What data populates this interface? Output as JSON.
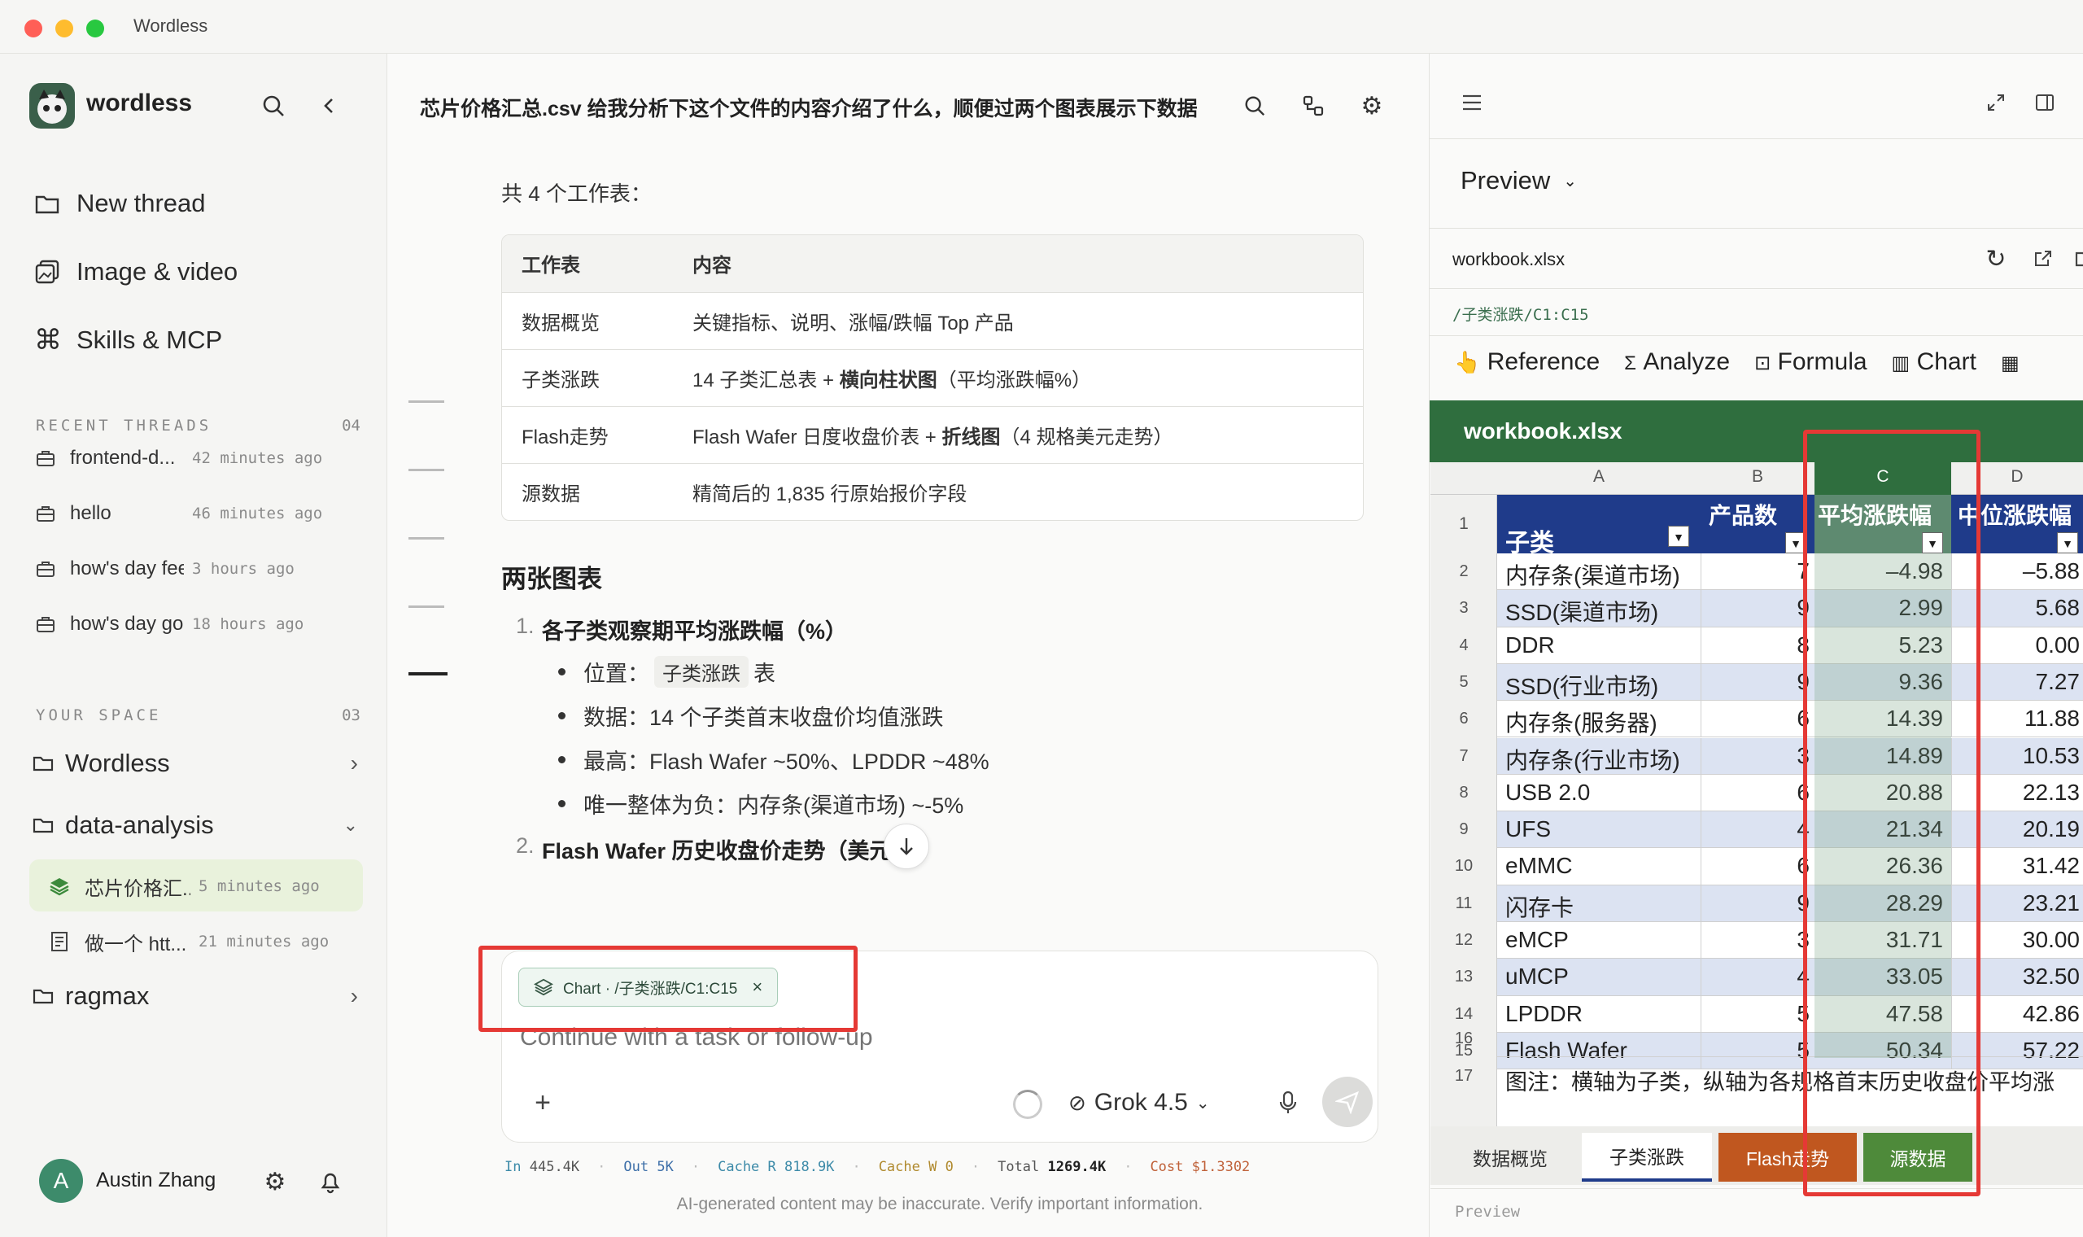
{
  "app": {
    "title": "Wordless"
  },
  "sidebar": {
    "brand": "wordless",
    "nav": [
      {
        "label": "New thread",
        "icon": "folder-icon"
      },
      {
        "label": "Image & video",
        "icon": "image-icon"
      },
      {
        "label": "Skills & MCP",
        "icon": "command-icon"
      }
    ],
    "recent_header": "RECENT THREADS",
    "recent_count": "04",
    "recent": [
      {
        "name": "frontend-d...",
        "time": "42 minutes ago"
      },
      {
        "name": "hello",
        "time": "46 minutes ago"
      },
      {
        "name": "how's day feeli...",
        "time": "3 hours ago"
      },
      {
        "name": "how's day goi...",
        "time": "18 hours ago"
      }
    ],
    "space_header": "YOUR SPACE",
    "space_count": "03",
    "folders": [
      {
        "name": "Wordless"
      },
      {
        "name": "data-analysis"
      },
      {
        "name": "ragmax"
      }
    ],
    "subthreads": [
      {
        "name": "芯片价格汇...",
        "time": "5 minutes ago"
      },
      {
        "name": "做一个 htt...",
        "time": "21 minutes ago"
      }
    ],
    "user": {
      "name": "Austin Zhang",
      "initial": "A"
    }
  },
  "chat": {
    "title": "芯片价格汇总.csv 给我分析下这个文件的内容介绍了什么，顺便过两个图表展示下数据",
    "sheets_intro": "共 4 个工作表：",
    "table_headers": [
      "工作表",
      "内容"
    ],
    "table_rows": [
      [
        "数据概览",
        "关键指标、说明、涨幅/跌幅 Top 产品"
      ],
      [
        "子类涨跌",
        "14 子类汇总表 + ",
        "横向柱状图",
        "（平均涨跌幅%）"
      ],
      [
        "Flash走势",
        "Flash Wafer 日度收盘价表 + ",
        "折线图",
        "（4 规格美元走势）"
      ],
      [
        "源数据",
        "精简后的 1,835 行原始报价字段"
      ]
    ],
    "charts_heading": "两张图表",
    "list1_num": "1.",
    "list1_title": "各子类观察期平均涨跌幅（%）",
    "bullet_pos_prefix": "位置：",
    "bullet_pos_tag": "子类涨跌",
    "bullet_pos_suffix": "表",
    "bullet_data": "数据：14 个子类首末收盘价均值涨跌",
    "bullet_high": "最高：Flash Wafer ~50%、LPDDR ~48%",
    "bullet_neg": "唯一整体为负：内存条(渠道市场) ~-5%",
    "list2_num": "2.",
    "list2_title": "Flash Wafer 历史收盘价走势（美元",
    "composer": {
      "chip": "Chart · /子类涨跌/C1:C15",
      "placeholder": "Continue with a task or follow-up",
      "model": "Grok 4.5"
    },
    "stats": [
      {
        "k": "In",
        "v": "445.4K"
      },
      {
        "k": "Out",
        "v": "5K"
      },
      {
        "k": "Cache R",
        "v": "818.9K"
      },
      {
        "k": "Cache W",
        "v": "0"
      },
      {
        "k": "Total",
        "v": "1269.4K"
      },
      {
        "k": "Cost",
        "v": "$1.3302"
      }
    ],
    "disclaimer": "AI-generated content may be inaccurate. Verify important information."
  },
  "preview": {
    "label": "Preview",
    "file": "workbook.xlsx",
    "path": "/子类涨跌/C1:C15",
    "tools": [
      "Reference",
      "Analyze",
      "Formula",
      "Chart"
    ],
    "sheet_title": "workbook.xlsx",
    "col_letters": [
      "A",
      "B",
      "C",
      "D"
    ],
    "headers": [
      "子类",
      "产品数",
      "平均涨跌幅",
      "中位涨跌幅"
    ],
    "rows": [
      {
        "n": "2",
        "a": "内存条(渠道市场)",
        "b": "7",
        "c": "–4.98",
        "d": "–5.88"
      },
      {
        "n": "3",
        "a": "SSD(渠道市场)",
        "b": "9",
        "c": "2.99",
        "d": "5.68"
      },
      {
        "n": "4",
        "a": "DDR",
        "b": "8",
        "c": "5.23",
        "d": "0.00"
      },
      {
        "n": "5",
        "a": "SSD(行业市场)",
        "b": "9",
        "c": "9.36",
        "d": "7.27"
      },
      {
        "n": "6",
        "a": "内存条(服务器)",
        "b": "6",
        "c": "14.39",
        "d": "11.88"
      },
      {
        "n": "7",
        "a": "内存条(行业市场)",
        "b": "3",
        "c": "14.89",
        "d": "10.53"
      },
      {
        "n": "8",
        "a": "USB 2.0",
        "b": "6",
        "c": "20.88",
        "d": "22.13"
      },
      {
        "n": "9",
        "a": "UFS",
        "b": "4",
        "c": "21.34",
        "d": "20.19"
      },
      {
        "n": "10",
        "a": "eMMC",
        "b": "6",
        "c": "26.36",
        "d": "31.42"
      },
      {
        "n": "11",
        "a": "闪存卡",
        "b": "9",
        "c": "28.29",
        "d": "23.21"
      },
      {
        "n": "12",
        "a": "eMCP",
        "b": "3",
        "c": "31.71",
        "d": "30.00"
      },
      {
        "n": "13",
        "a": "uMCP",
        "b": "4",
        "c": "33.05",
        "d": "32.50"
      },
      {
        "n": "14",
        "a": "LPDDR",
        "b": "5",
        "c": "47.58",
        "d": "42.86"
      },
      {
        "n": "15",
        "a": "Flash Wafer",
        "b": "5",
        "c": "50.34",
        "d": "57.22"
      }
    ],
    "row16": "16",
    "row17_n": "17",
    "row17_text": "图注：横轴为子类，纵轴为各规格首末历史收盘价平均涨",
    "sheet_tabs": [
      "数据概览",
      "子类涨跌",
      "Flash走势",
      "源数据"
    ],
    "footer": "Preview"
  }
}
